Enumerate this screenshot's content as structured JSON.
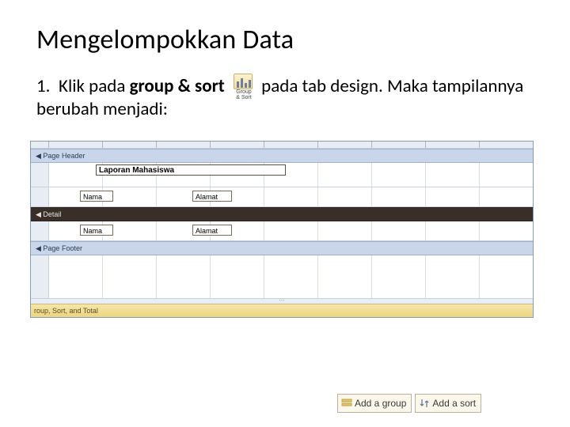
{
  "title": "Mengelompokkan Data",
  "list_number": "1.",
  "text": {
    "p1a": "Klik pada ",
    "p1b_bold": "group & sort",
    "p1c": " pada tab design. Maka tampilannya berubah menjadi:"
  },
  "icon": {
    "caption_line1": "Group",
    "caption_line2": "& Sort"
  },
  "designer": {
    "sections": {
      "page_header": "Page Header",
      "detail": "Detail",
      "page_footer": "Page Footer"
    },
    "report_title": "Laporan Mahasiswa",
    "labels": {
      "nama": "Nama",
      "alamat": "Alamat"
    },
    "gst_label": "roup, Sort, and Total"
  },
  "buttons": {
    "add_group": "Add a group",
    "add_sort": "Add a sort"
  }
}
